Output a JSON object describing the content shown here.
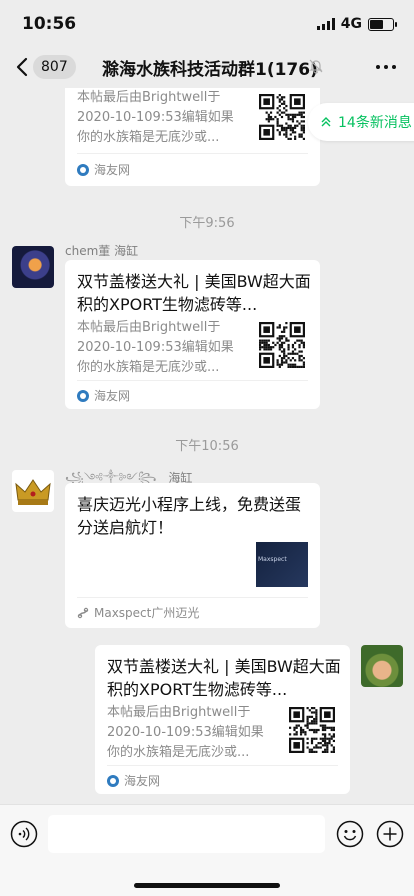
{
  "status": {
    "time": "10:56",
    "network": "4G"
  },
  "nav": {
    "unread_count": "807",
    "title": "滁海水族科技活动群1(176)"
  },
  "new_messages": {
    "label": "14条新消息"
  },
  "messages": [
    {
      "type": "card",
      "desc": [
        "本帖最后由Brightwell于",
        "2020-10-109:53编辑如果",
        "你的水族箱是无底沙或..."
      ],
      "source": "海友网"
    },
    {
      "type": "time",
      "text": "下午9:56"
    },
    {
      "type": "card",
      "sender": "chem董 海缸",
      "title": "双节盖楼送大礼 | 美国BW超大面积的XPORT生物滤砖等...",
      "desc": [
        "本帖最后由Brightwell于",
        "2020-10-109:53编辑如果",
        "你的水族箱是无底沙或..."
      ],
      "source": "海友网"
    },
    {
      "type": "time",
      "text": "下午10:56"
    },
    {
      "type": "miniprogram",
      "sender_decor": "꧁༺༒༻꧂",
      "sender": "海缸",
      "title": "喜庆迈光小程序上线，免费送蛋分送启航灯！",
      "thumb_caption": "Maxspect",
      "source": "Maxspect广州迈光"
    },
    {
      "type": "card",
      "self": true,
      "title": "双节盖楼送大礼 | 美国BW超大面积的XPORT生物滤砖等...",
      "desc": [
        "本帖最后由Brightwell于",
        "2020-10-109:53编辑如果",
        "你的水族箱是无底沙或..."
      ],
      "source": "海友网"
    }
  ],
  "colors": {
    "accent": "#07c160",
    "bg": "#ededed",
    "card": "#ffffff",
    "pill": "#dadada"
  },
  "icons": [
    "back-icon",
    "mute-icon",
    "more-icon",
    "chevron-up-icon",
    "voice-icon",
    "emoji-icon",
    "plus-icon"
  ]
}
